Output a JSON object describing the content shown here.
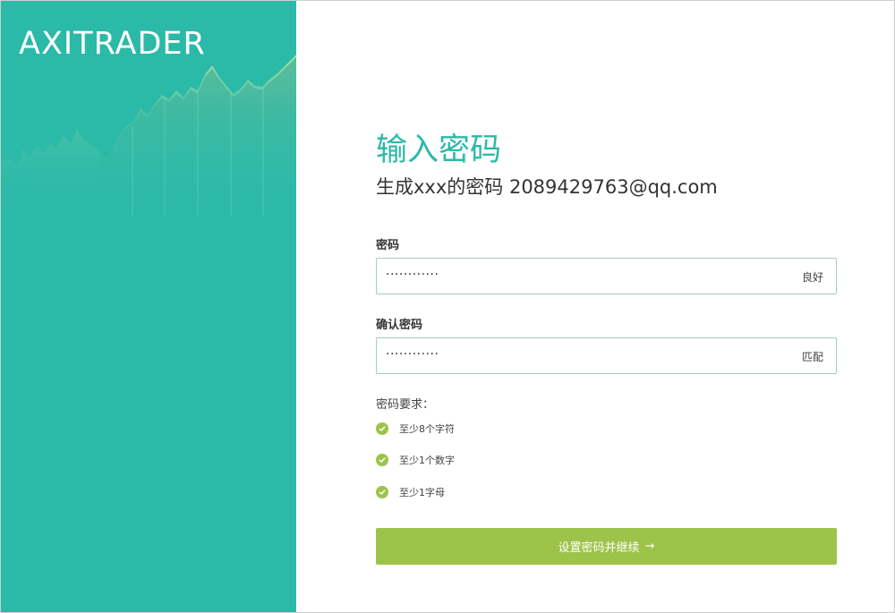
{
  "brand": {
    "logo": "AXITRADER"
  },
  "form": {
    "title": "输入密码",
    "subtitle": "生成xxx的密码 2089429763@qq.com",
    "password": {
      "label": "密码",
      "value": "············",
      "status": "良好"
    },
    "confirm": {
      "label": "确认密码",
      "value": "············",
      "status": "匹配"
    },
    "requirements": {
      "title": "密码要求：",
      "items": [
        "至少8个字符",
        "至少1个数字",
        "至少1字母"
      ]
    },
    "submit_label": "设置密码并继续",
    "submit_arrow": "→"
  },
  "colors": {
    "brand_teal": "#2bb9a8",
    "accent_green": "#9dc34a"
  }
}
